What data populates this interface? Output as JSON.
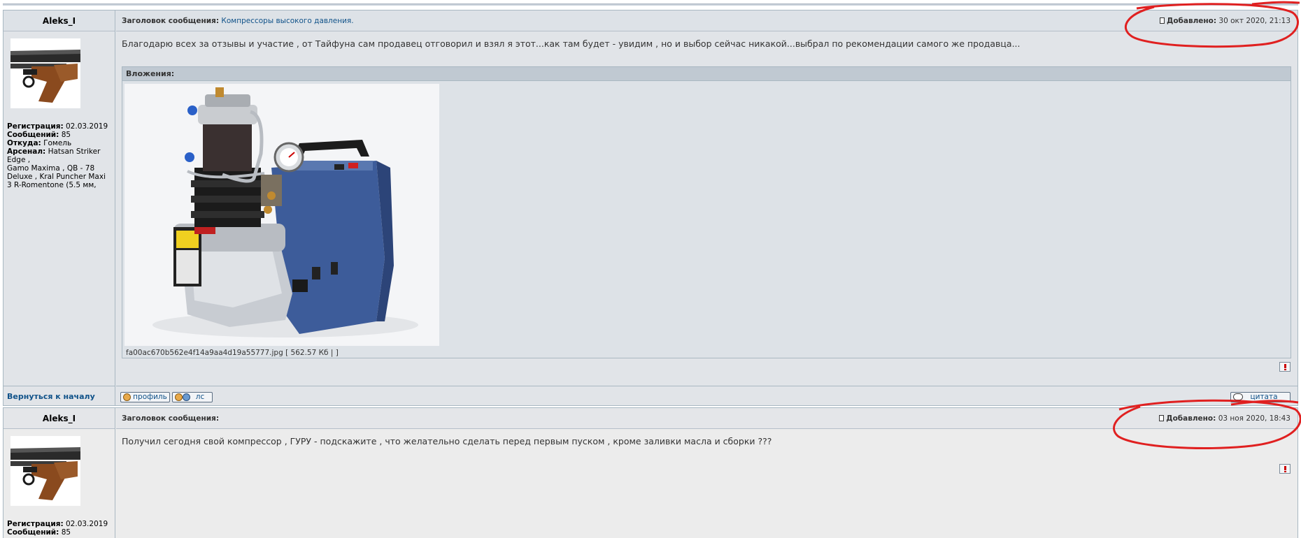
{
  "posts": [
    {
      "author": "Aleks_I",
      "profile": {
        "reg_label": "Регистрация:",
        "reg_value": "02.03.2019",
        "msgs_label": "Сообщений:",
        "msgs_value": "85",
        "from_label": "Откуда:",
        "from_value": "Гомель",
        "arsenal_label": "Арсенал:",
        "arsenal_line1": "Hatsan Striker",
        "arsenal_line2": "Edge ,",
        "arsenal_line3": "Gamo Maxima , QB - 78",
        "arsenal_line4": "Deluxe , Kral Puncher Maxi",
        "arsenal_line5": "3 R-Romentone (5.5 мм,"
      },
      "subject_label": "Заголовок сообщения:",
      "subject_value": "Компрессоры высокого давления.",
      "date_label": "Добавлено:",
      "date_value": "30 окт 2020, 21:13",
      "message": "Благодарю всех за отзывы и участие , от Тайфуна сам продавец отговорил и взял я этот...как там будет - увидим , но и выбор сейчас никакой...выбрал по рекомендации самого же продавца...",
      "attachments_title": "Вложения:",
      "attachment_file": "fa00ac670b562e4f14a9aa4d19a55777.jpg [ 562.57 Кб | ]",
      "back_to_top": "Вернуться к началу",
      "buttons": {
        "profile": "профиль",
        "pm": "лс",
        "quote": "цитата"
      }
    },
    {
      "author": "Aleks_I",
      "profile": {
        "reg_label": "Регистрация:",
        "reg_value": "02.03.2019",
        "msgs_label": "Сообщений:",
        "msgs_value": "85"
      },
      "subject_label": "Заголовок сообщения:",
      "date_label": "Добавлено:",
      "date_value": "03 ноя 2020, 18:43",
      "message": "Получил сегодня свой компрессор , ГУРУ - подскажите , что желательно сделать перед первым пуском , кроме заливки масла и сборки ???"
    }
  ],
  "colors": {
    "link": "#105289",
    "annotation_red": "#e02020",
    "post_bg": "#e1e4e8",
    "post_alt_bg": "#ececec"
  }
}
